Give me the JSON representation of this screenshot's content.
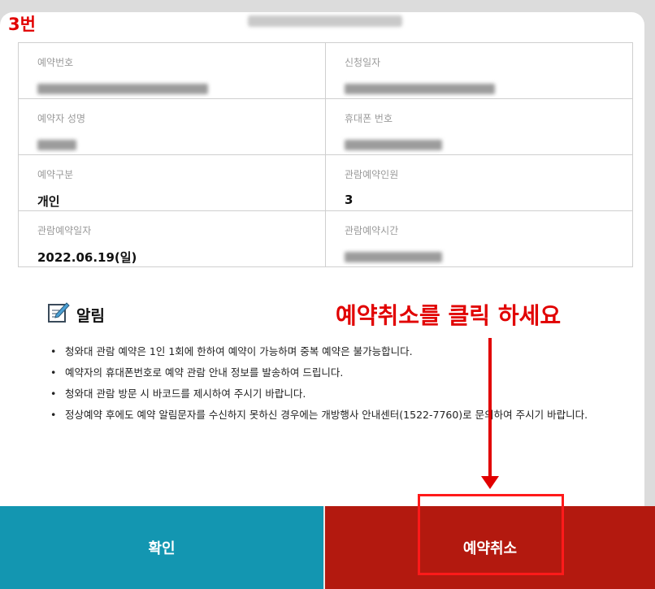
{
  "step_label": "3번",
  "info": {
    "reservation_number": {
      "label": "예약번호"
    },
    "application_date": {
      "label": "신청일자"
    },
    "reserver_name": {
      "label": "예약자 성명"
    },
    "phone_number": {
      "label": "휴대폰 번호"
    },
    "reservation_type": {
      "label": "예약구분",
      "value": "개인"
    },
    "visitor_count": {
      "label": "관람예약인원",
      "value": "3"
    },
    "visit_date": {
      "label": "관람예약일자",
      "value": "2022.06.19(일)"
    },
    "visit_time": {
      "label": "관람예약시간"
    }
  },
  "notice": {
    "title": "알림",
    "items": [
      "청와대 관람 예약은 1인 1회에 한하여 예약이 가능하며 중복 예약은 불가능합니다.",
      "예약자의 휴대폰번호로 예약 관람 안내 정보를 발송하여 드립니다.",
      "청와대 관람 방문 시 바코드를 제시하여 주시기 바랍니다.",
      "정상예약 후에도 예약 알림문자를 수신하지 못하신 경우에는 개방행사 안내센터(1522-7760)로 문의하여 주시기 바랍니다."
    ]
  },
  "annotation": "예약취소를 클릭 하세요",
  "buttons": {
    "confirm": "확인",
    "cancel": "예약취소"
  },
  "colors": {
    "confirm": "#1396b1",
    "cancel": "#b3190f",
    "annotation": "#e10000"
  }
}
